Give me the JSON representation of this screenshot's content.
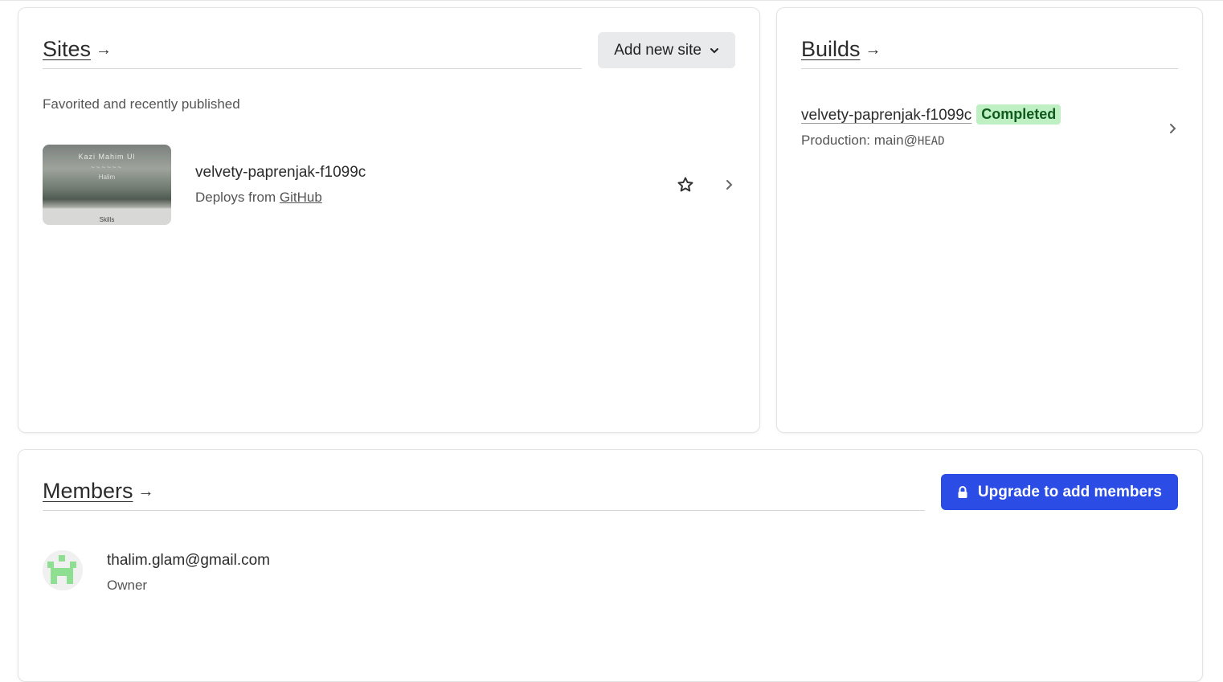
{
  "sites": {
    "heading": "Sites",
    "arrow": "→",
    "add_button_label": "Add new site",
    "subtitle": "Favorited and recently published",
    "items": [
      {
        "name": "velvety-paprenjak-f1099c",
        "deploy_prefix": "Deploys from",
        "deploy_source": "GitHub",
        "thumbnail": {
          "line1": "Kazi Mahim Ul",
          "line2": "~~~~~~",
          "line3": "Halim",
          "footer": "Skills"
        }
      }
    ]
  },
  "builds": {
    "heading": "Builds",
    "arrow": "→",
    "items": [
      {
        "name": "velvety-paprenjak-f1099c",
        "status": "Completed",
        "context_prefix": "Production: main@",
        "ref": "HEAD"
      }
    ]
  },
  "members": {
    "heading": "Members",
    "arrow": "→",
    "upgrade_button_label": "Upgrade to add members",
    "items": [
      {
        "email": "thalim.glam@gmail.com",
        "role": "Owner"
      }
    ]
  },
  "colors": {
    "accent_blue": "#2b4de6",
    "badge_green_bg": "#bff0c4",
    "badge_green_text": "#0f5a1c",
    "avatar_green": "#8fdf93"
  },
  "icons": [
    "chevron-down-icon",
    "star-icon",
    "chevron-right-icon",
    "lock-icon",
    "avatar-identicon"
  ]
}
